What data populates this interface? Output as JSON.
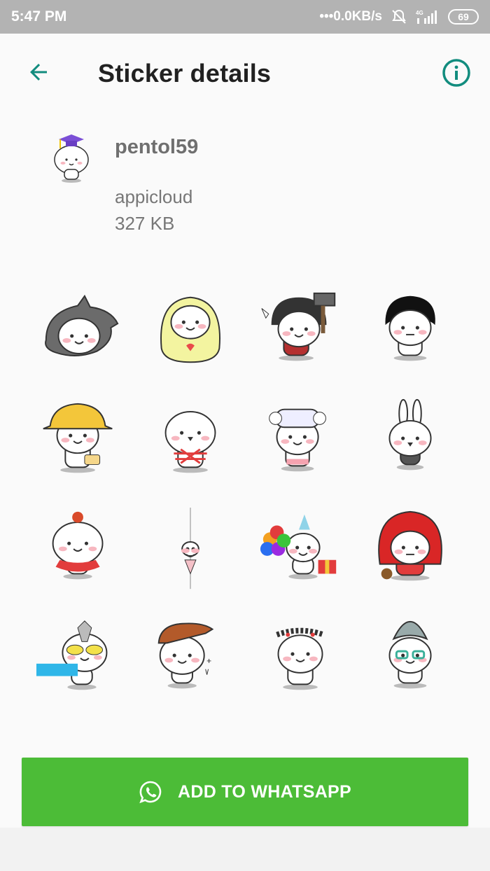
{
  "status_bar": {
    "time": "5:47 PM",
    "network_speed": "•••0.0KB/s",
    "network_type": "4G",
    "battery": "69"
  },
  "appbar": {
    "title": "Sticker details",
    "back_icon": "arrow-back-icon",
    "info_icon": "info-icon"
  },
  "pack": {
    "name": "pentol59",
    "publisher": "appicloud",
    "size": "327 KB"
  },
  "stickers": [
    "wolf-hood",
    "yellow-doll",
    "viking-hammer",
    "black-hair",
    "yellow-hat",
    "tied-ribbon",
    "hair-rollers",
    "bunny-ears",
    "tutu-dancer",
    "hanging-small",
    "party-balloons",
    "red-hood",
    "ultraman",
    "hi-baby",
    "flower-crown",
    "grandma-glasses",
    "partial-1",
    "partial-2",
    "partial-3",
    "partial-4"
  ],
  "action": {
    "label": "ADD TO WHATSAPP",
    "icon": "whatsapp-icon"
  },
  "colors": {
    "accent": "#128c7e",
    "button": "#4cbc37",
    "status_bar": "#b3b3b3"
  }
}
